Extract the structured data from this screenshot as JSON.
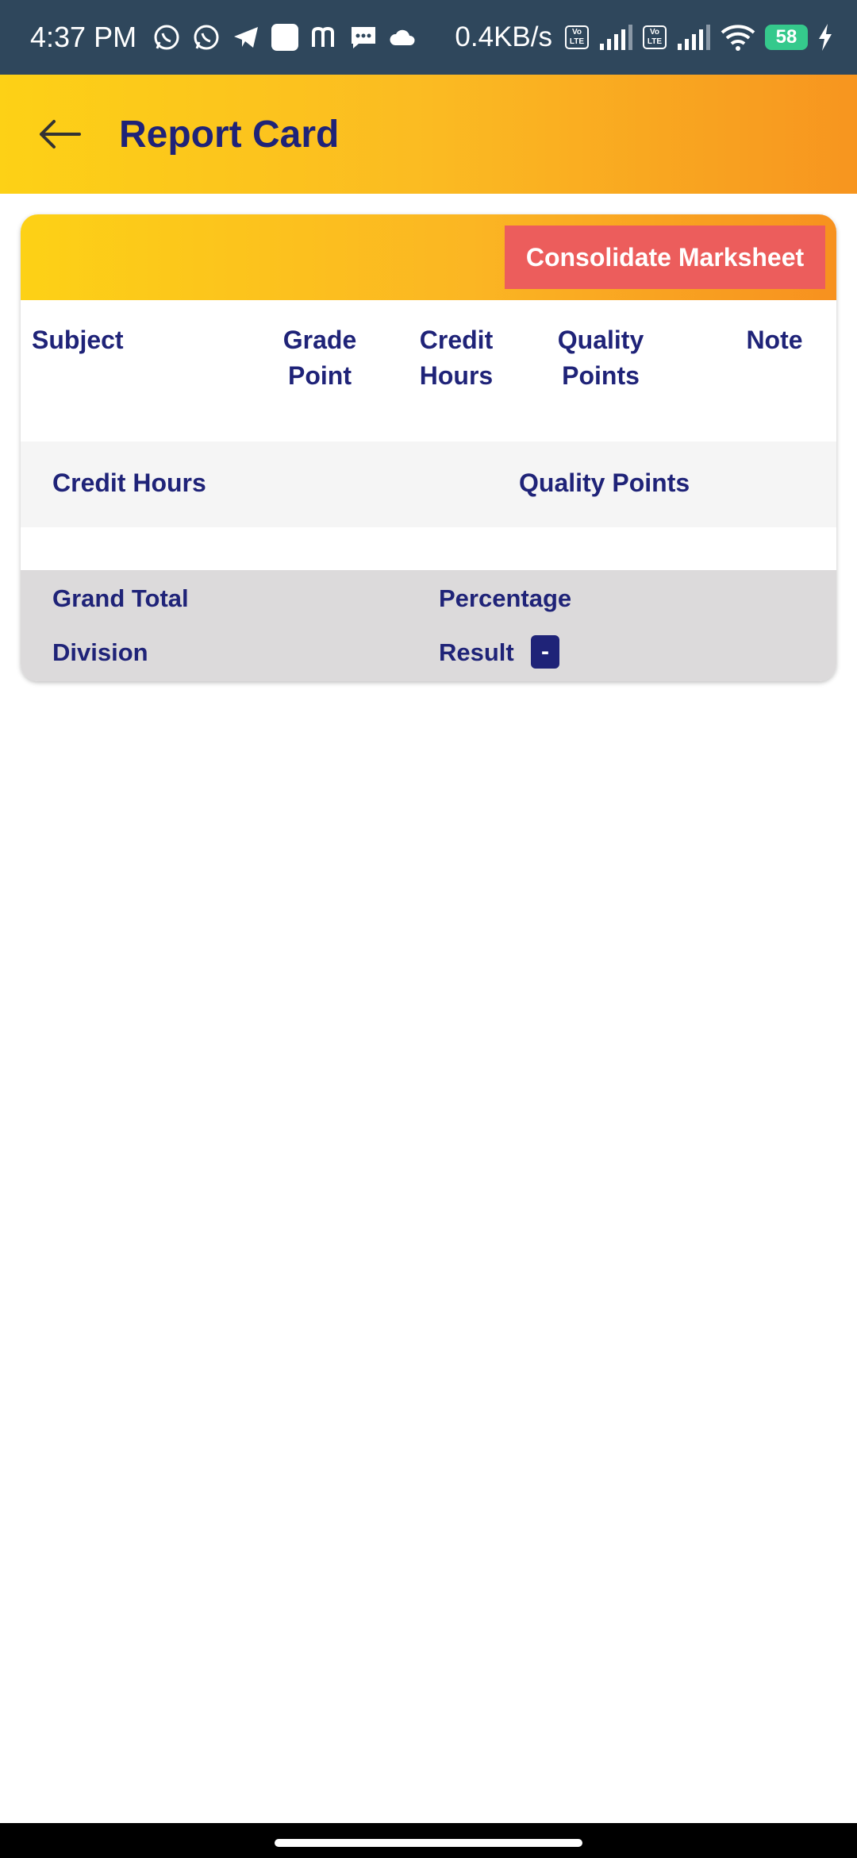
{
  "status_bar": {
    "time": "4:37 PM",
    "network_speed": "0.4KB/s",
    "volte_label": "Vo LTE",
    "battery": "58",
    "icons": [
      "whatsapp-icon",
      "whatsapp-icon",
      "telegram-icon",
      "app-square-icon",
      "m-app-icon",
      "message-icon",
      "cloud-icon",
      "volte-icon",
      "signal-icon",
      "wifi-icon",
      "battery-icon",
      "charging-icon"
    ]
  },
  "app_bar": {
    "title": "Report Card",
    "back_icon": "arrow-left-icon"
  },
  "card": {
    "consolidate_button": "Consolidate Marksheet",
    "columns": {
      "subject": "Subject",
      "grade_point": "Grade Point",
      "credit_hours": "Credit Hours",
      "quality_points": "Quality Points",
      "note": "Note"
    },
    "summary": {
      "credit_hours": "Credit Hours",
      "quality_points": "Quality Points"
    },
    "totals": {
      "grand_total": "Grand Total",
      "percentage": "Percentage",
      "division": "Division",
      "result": "Result",
      "result_value": "-"
    }
  },
  "colors": {
    "status_bar": "#2f475c",
    "accent_yellow": "#fdd116",
    "accent_orange": "#f7951f",
    "title_navy": "#1f2378",
    "button_red": "#ec5d5c",
    "totals_bg": "#dcdadb"
  }
}
